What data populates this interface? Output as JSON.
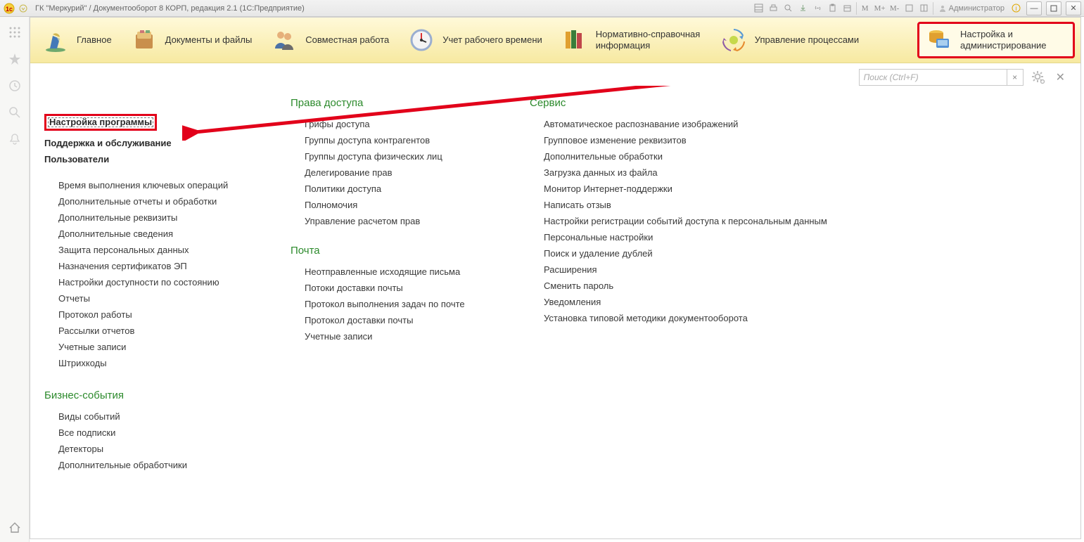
{
  "title_bar": {
    "app_title": "ГК \"Меркурий\" / Документооборот 8 КОРП, редакция 2.1  (1С:Предприятие)",
    "admin_label": "Администратор",
    "m_labels": [
      "M",
      "M+",
      "M-"
    ]
  },
  "nav": {
    "items": [
      {
        "label": "Главное"
      },
      {
        "label": "Документы и файлы"
      },
      {
        "label": "Совместная работа"
      },
      {
        "label": "Учет рабочего времени"
      },
      {
        "label": "Нормативно-справочная информация"
      },
      {
        "label": "Управление процессами"
      },
      {
        "label": "Настройка и администрирование"
      }
    ]
  },
  "search": {
    "placeholder": "Поиск (Ctrl+F)"
  },
  "col1": {
    "highlight": "Настройка программы",
    "bold_items": [
      "Поддержка и обслуживание",
      "Пользователи"
    ],
    "links1": [
      "Время выполнения ключевых операций",
      "Дополнительные отчеты и обработки",
      "Дополнительные реквизиты",
      "Дополнительные сведения",
      "Защита персональных данных",
      "Назначения сертификатов ЭП",
      "Настройки доступности по состоянию",
      "Отчеты",
      "Протокол работы",
      "Рассылки отчетов",
      "Учетные записи",
      "Штрихкоды"
    ],
    "section2_title": "Бизнес-события",
    "links2": [
      "Виды событий",
      "Все подписки",
      "Детекторы",
      "Дополнительные обработчики"
    ]
  },
  "col2": {
    "section1_title": "Права доступа",
    "links1": [
      "Грифы доступа",
      "Группы доступа контрагентов",
      "Группы доступа физических лиц",
      "Делегирование прав",
      "Политики доступа",
      "Полномочия",
      "Управление расчетом прав"
    ],
    "section2_title": "Почта",
    "links2": [
      "Неотправленные исходящие письма",
      "Потоки доставки почты",
      "Протокол выполнения задач по почте",
      "Протокол доставки почты",
      "Учетные записи"
    ]
  },
  "col3": {
    "section1_title": "Сервис",
    "links1": [
      "Автоматическое распознавание изображений",
      "Групповое изменение реквизитов",
      "Дополнительные обработки",
      "Загрузка данных из файла",
      "Монитор Интернет-поддержки",
      "Написать отзыв",
      "Настройки регистрации событий доступа к персональным данным",
      "Персональные настройки",
      "Поиск и удаление дублей",
      "Расширения",
      "Сменить пароль",
      "Уведомления",
      "Установка типовой методики документооборота"
    ]
  }
}
